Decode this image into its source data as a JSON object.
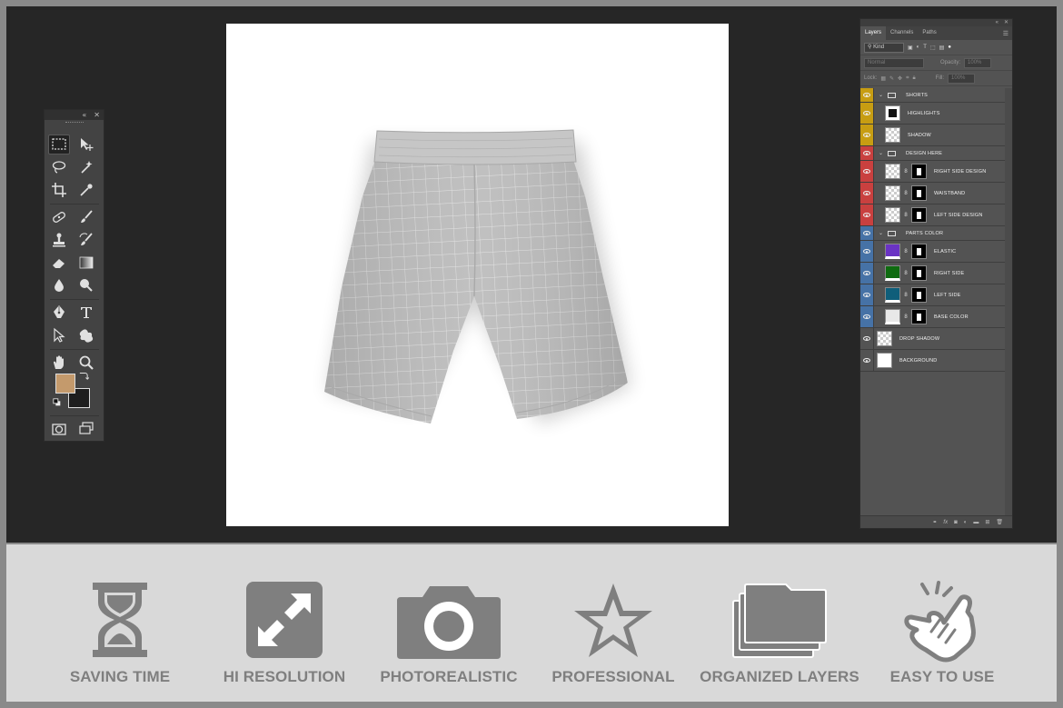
{
  "tools_panel": {
    "collapse_icon": "«",
    "close_icon": "✕",
    "foreground_color": "#c49a6c",
    "background_color": "#1e1e1e"
  },
  "layers_panel": {
    "tabs": [
      "Layers",
      "Channels",
      "Paths"
    ],
    "filter_kind": "Kind",
    "blend_mode": "Normal",
    "opacity_label": "Opacity:",
    "opacity_value": "100%",
    "lock_label": "Lock:",
    "fill_label": "Fill:",
    "fill_value": "100%",
    "layers": [
      {
        "name": "SHORTS",
        "type": "group",
        "color": "#c79d12"
      },
      {
        "name": "HIGHLIGHTS",
        "type": "layer",
        "color": "#c79d12"
      },
      {
        "name": "SHADOW",
        "type": "layer",
        "color": "#c79d12"
      },
      {
        "name": "DESIGN HERE",
        "type": "group",
        "color": "#c9403f"
      },
      {
        "name": "RIGHT SIDE DESIGN",
        "type": "smart-masked",
        "color": "#c9403f"
      },
      {
        "name": "WAISTBAND",
        "type": "smart-masked",
        "color": "#c9403f"
      },
      {
        "name": "LEFT SIDE DESIGN",
        "type": "smart-masked",
        "color": "#c9403f"
      },
      {
        "name": "PARTS COLOR",
        "type": "group",
        "color": "#4672a6"
      },
      {
        "name": "ELASTIC",
        "type": "fill-masked",
        "color": "#4672a6",
        "fill": "#6a33c4"
      },
      {
        "name": "RIGHT SIDE",
        "type": "fill-masked",
        "color": "#4672a6",
        "fill": "#0f6b10"
      },
      {
        "name": "LEFT SIDE",
        "type": "fill-masked",
        "color": "#4672a6",
        "fill": "#0f5e7a"
      },
      {
        "name": "BASE COLOR",
        "type": "fill-masked",
        "color": "#4672a6",
        "fill": "#e8e8e8"
      },
      {
        "name": "DROP SHADOW",
        "type": "layer",
        "color": "none"
      },
      {
        "name": "BACKGROUND",
        "type": "background",
        "color": "none"
      }
    ]
  },
  "features": [
    {
      "label": "SAVING TIME",
      "icon": "hourglass-icon"
    },
    {
      "label": "HI RESOLUTION",
      "icon": "expand-arrows-icon"
    },
    {
      "label": "PHOTOREALISTIC",
      "icon": "camera-icon"
    },
    {
      "label": "PROFESSIONAL",
      "icon": "star-icon"
    },
    {
      "label": "ORGANIZED LAYERS",
      "icon": "stacked-folders-icon"
    },
    {
      "label": "EASY TO USE",
      "icon": "tap-hand-icon"
    }
  ]
}
